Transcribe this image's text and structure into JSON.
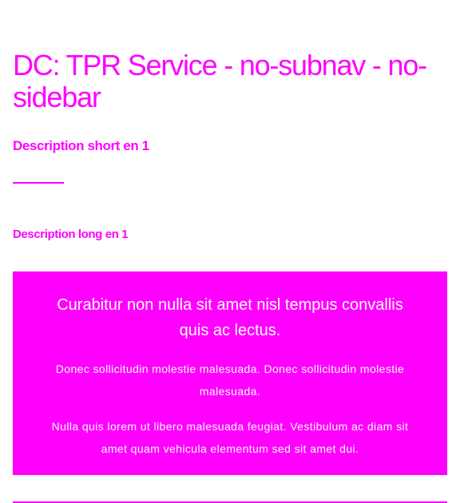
{
  "page": {
    "title": "DC: TPR Service - no-subnav - no-sidebar",
    "description_short": "Description short en 1",
    "description_long": "Description long en 1"
  },
  "callout": {
    "heading": "Curabitur non nulla sit amet nisl tempus convallis quis ac lectus.",
    "paragraphs": [
      "Donec sollicitudin molestie malesuada. Donec sollicitudin molestie malesuada.",
      "Nulla quis lorem ut libero malesuada feugiat. Vestibulum ac diam sit amet quam vehicula elementum sed sit amet dui."
    ]
  },
  "colors": {
    "accent": "#ff00ff",
    "callout_text": "#ffffff",
    "background": "#ffffff"
  }
}
